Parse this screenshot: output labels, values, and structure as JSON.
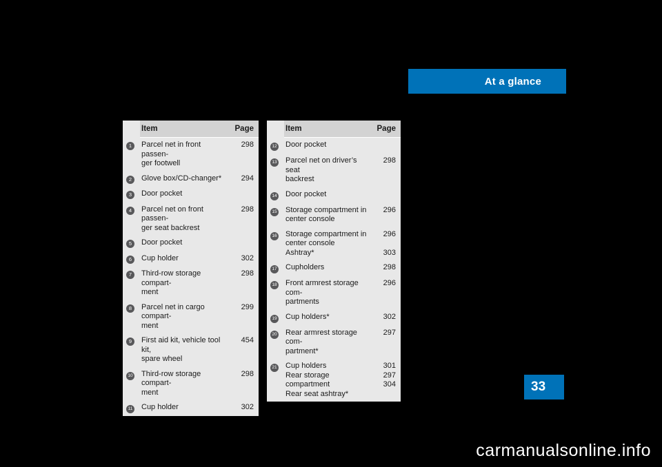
{
  "header": {
    "title": "At a glance"
  },
  "page": {
    "number": "33"
  },
  "watermark": "carmanualsonline.info",
  "colors": {
    "accent": "#0072b8",
    "table_bg": "#e8e8e8",
    "table_header_bg": "#d3d3d3",
    "circle_bg": "#58585a",
    "background": "#000000"
  },
  "tables": [
    {
      "id": "left",
      "columns": [
        "Item",
        "Page"
      ],
      "rows": [
        {
          "num": "1",
          "item": "Parcel net in front passen-\nger footwell",
          "page": "298"
        },
        {
          "num": "2",
          "item": "Glove box/CD-changer*",
          "page": "294"
        },
        {
          "num": "3",
          "item": "Door pocket",
          "page": ""
        },
        {
          "num": "4",
          "item": "Parcel net on front passen-\nger seat backrest",
          "page": "298"
        },
        {
          "num": "5",
          "item": "Door pocket",
          "page": ""
        },
        {
          "num": "6",
          "item": "Cup holder",
          "page": "302"
        },
        {
          "num": "7",
          "item": "Third-row storage compart-\nment",
          "page": "298"
        },
        {
          "num": "8",
          "item": "Parcel net in cargo compart-\nment",
          "page": "299"
        },
        {
          "num": "9",
          "item": "First aid kit, vehicle tool kit,\nspare wheel",
          "page": "454"
        },
        {
          "num": "10",
          "item": "Third-row storage compart-\nment",
          "page": "298"
        },
        {
          "num": "11",
          "item": "Cup holder",
          "page": "302"
        }
      ]
    },
    {
      "id": "right",
      "columns": [
        "Item",
        "Page"
      ],
      "rows": [
        {
          "num": "12",
          "item": "Door pocket",
          "page": ""
        },
        {
          "num": "13",
          "item": "Parcel net on driver’s seat\nbackrest",
          "page": "298"
        },
        {
          "num": "14",
          "item": "Door pocket",
          "page": ""
        },
        {
          "num": "15",
          "item": "Storage compartment in\ncenter console",
          "page": "296"
        },
        {
          "num": "16",
          "item": "Storage compartment in\ncenter console\nAshtray*",
          "page": "296\n\n303"
        },
        {
          "num": "17",
          "item": "Cupholders",
          "page": "298"
        },
        {
          "num": "18",
          "item": "Front armrest storage com-\npartments",
          "page": "296"
        },
        {
          "num": "19",
          "item": "Cup holders*",
          "page": "302"
        },
        {
          "num": "20",
          "item": "Rear armrest storage com-\npartment*",
          "page": "297"
        },
        {
          "num": "21",
          "item": "Cup holders\nRear storage compartment\nRear seat ashtray*",
          "page": "301\n297\n304"
        }
      ]
    }
  ]
}
